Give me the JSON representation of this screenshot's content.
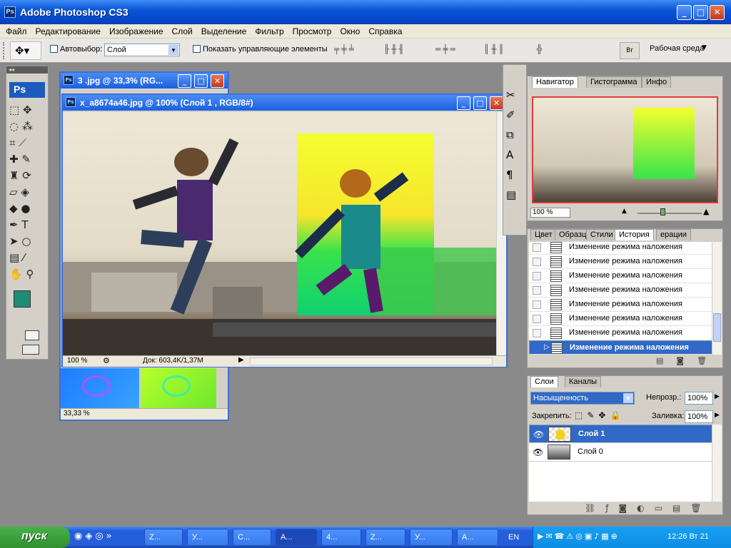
{
  "app": {
    "title": "Adobe Photoshop CS3",
    "icon": "Ps"
  },
  "window_controls": {
    "min": "_",
    "max": "□",
    "close": "✕"
  },
  "menu": [
    "Файл",
    "Редактирование",
    "Изображение",
    "Слой",
    "Выделение",
    "Фильтр",
    "Просмотр",
    "Окно",
    "Справка"
  ],
  "options": {
    "auto_select_label": "Автовыбор:",
    "auto_select_value": "Слой",
    "show_controls_label": "Показать управляющие элементы",
    "workspace_label": "Рабочая среда"
  },
  "tools": {
    "logo": "Ps",
    "fg_color": "#1f8c76",
    "bg_color": "#3fd8cc"
  },
  "doc_back": {
    "title": "3 .jpg @ 33,3% (RG...",
    "zoom": "33,33 %"
  },
  "doc_front": {
    "title": "x_a8674a46.jpg @ 100% (Слой 1 , RGB/8#)",
    "zoom": "100 %",
    "doc_size": "Док: 603,4K/1,37M"
  },
  "navigator": {
    "tabs": [
      "Навигатор",
      "Гистограмма",
      "Инфо"
    ],
    "zoom": "100 %"
  },
  "history": {
    "tabs": [
      "Цвет",
      "Образц",
      "Стили",
      "История",
      "ерации"
    ],
    "items": [
      "Изменение режима наложения",
      "Изменение режима наложения",
      "Изменение режима наложения",
      "Изменение режима наложения",
      "Изменение режима наложения",
      "Изменение режима наложения",
      "Изменение режима наложения",
      "Изменение режима наложения"
    ]
  },
  "layers": {
    "tabs": [
      "Слои",
      "Каналы"
    ],
    "blend_mode": "Насыщенность",
    "opacity_label": "Непрозр.:",
    "opacity": "100%",
    "lock_label": "Закрепить:",
    "fill_label": "Заливка:",
    "fill": "100%",
    "items": [
      {
        "name": "Слой 1"
      },
      {
        "name": "Слой 0"
      }
    ]
  },
  "taskbar": {
    "start": "пуск",
    "items": [
      "Z...",
      "У...",
      "C...",
      "A...",
      "4...",
      "Z...",
      "У...",
      "A..."
    ],
    "lang": "EN",
    "clock": "12:26 Вт 21"
  }
}
